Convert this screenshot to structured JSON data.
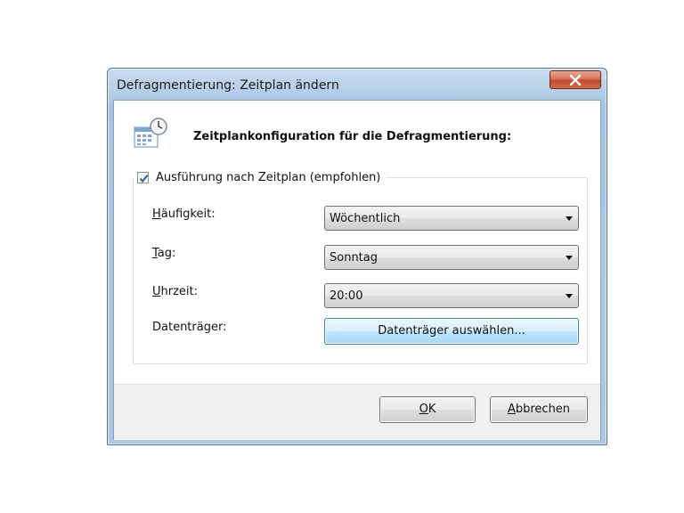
{
  "window": {
    "title": "Defragmentierung: Zeitplan ändern",
    "close_label": "x"
  },
  "header": {
    "title": "Zeitplankonfiguration für die Defragmentierung:",
    "icon": "calendar-clock-icon"
  },
  "schedule": {
    "checkbox_label": "Ausführung nach Zeitplan (empfohlen)",
    "checked": true,
    "frequency": {
      "label": "Häufigkeit:",
      "value": "Wöchentlich"
    },
    "day": {
      "label": "Tag:",
      "value": "Sonntag"
    },
    "time": {
      "label": "Uhrzeit:",
      "value": "20:00"
    },
    "disks": {
      "label": "Datenträger:",
      "button_label": "Datenträger auswählen..."
    }
  },
  "footer": {
    "ok_label": "OK",
    "cancel_label": "Abbrechen"
  },
  "colors": {
    "titlebar": "#b7cfe8",
    "close_button": "#c4472b",
    "focus_button": "#bee6fd"
  }
}
